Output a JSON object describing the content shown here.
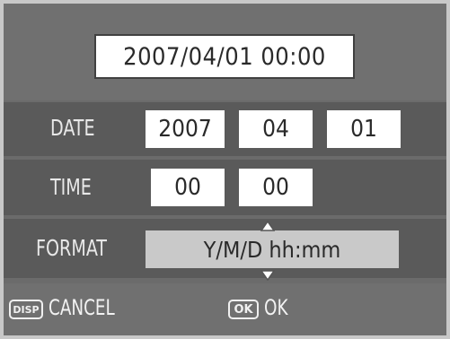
{
  "preview": {
    "datetime": "2007/04/01  00:00"
  },
  "date": {
    "label": "DATE",
    "year": "2007",
    "month": "04",
    "day": "01"
  },
  "time": {
    "label": "TIME",
    "hour": "00",
    "minute": "00"
  },
  "format": {
    "label": "FORMAT",
    "value": "Y/M/D  hh:mm"
  },
  "footer": {
    "cancel_icon": "DISP",
    "cancel_label": "CANCEL",
    "ok_icon": "OK",
    "ok_label": "OK"
  },
  "icons": {
    "up": "up-arrow-icon",
    "down": "down-arrow-icon"
  },
  "colors": {
    "screen_bg": "#6b6b6b",
    "field_bg": "#ffffff",
    "format_bg": "#c9c9c9",
    "text": "#2a2a2a"
  }
}
